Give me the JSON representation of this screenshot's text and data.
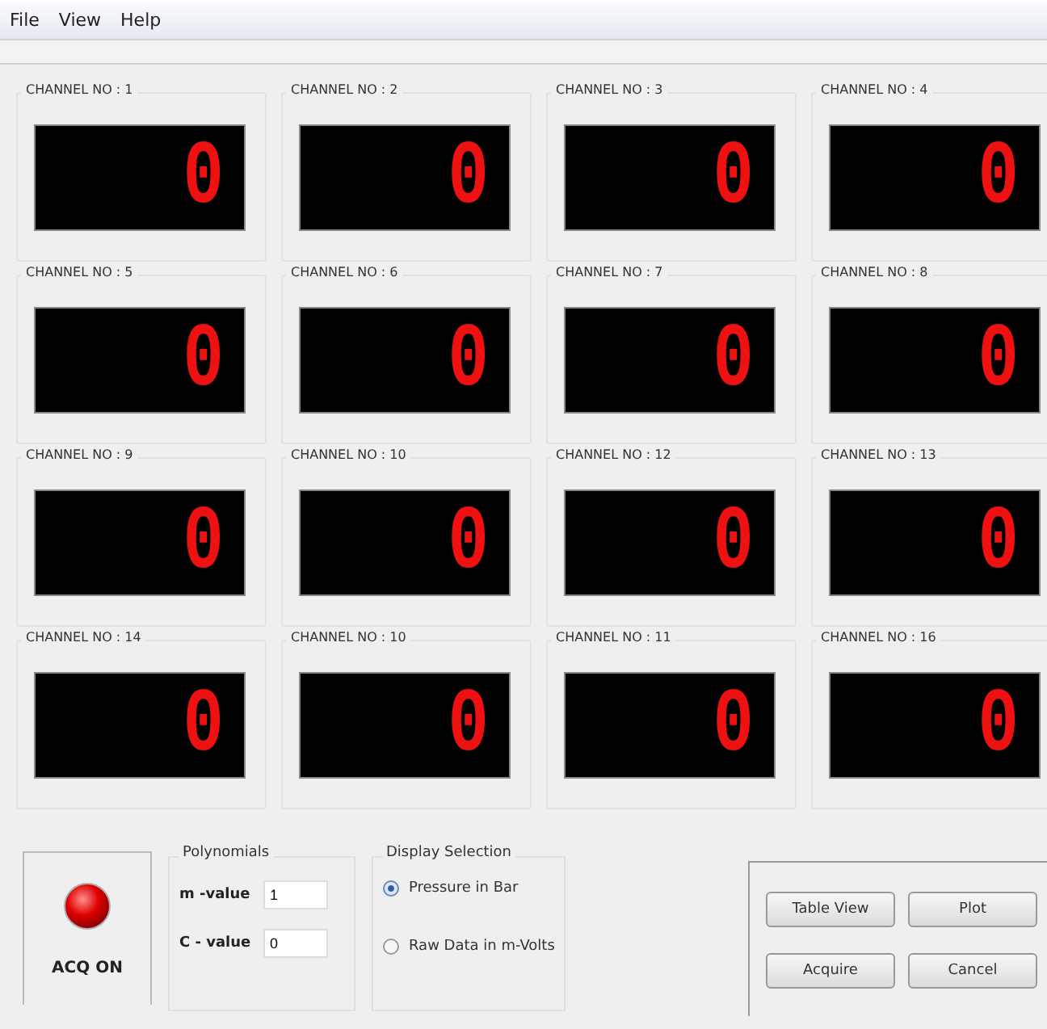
{
  "menu": [
    "File",
    "View",
    "Help"
  ],
  "channels": [
    {
      "label": "CHANNEL NO : 1",
      "value": "0"
    },
    {
      "label": "CHANNEL NO : 2",
      "value": "0"
    },
    {
      "label": "CHANNEL NO : 3",
      "value": "0"
    },
    {
      "label": "CHANNEL NO : 4",
      "value": "0"
    },
    {
      "label": "CHANNEL NO : 5",
      "value": "0"
    },
    {
      "label": "CHANNEL NO : 6",
      "value": "0"
    },
    {
      "label": "CHANNEL NO : 7",
      "value": "0"
    },
    {
      "label": "CHANNEL NO : 8",
      "value": "0"
    },
    {
      "label": "CHANNEL NO : 9",
      "value": "0"
    },
    {
      "label": "CHANNEL NO : 10",
      "value": "0"
    },
    {
      "label": "CHANNEL NO : 12",
      "value": "0"
    },
    {
      "label": "CHANNEL NO : 13",
      "value": "0"
    },
    {
      "label": "CHANNEL NO : 14",
      "value": "0"
    },
    {
      "label": "CHANNEL NO : 10",
      "value": "0"
    },
    {
      "label": "CHANNEL NO : 11",
      "value": "0"
    },
    {
      "label": "CHANNEL NO : 16",
      "value": "0"
    }
  ],
  "acquisition": {
    "label": "ACQ ON",
    "on": true
  },
  "polynomials": {
    "title": "Polynomials",
    "fields": [
      {
        "label": "m -value",
        "value": "1"
      },
      {
        "label": "C - value",
        "value": "0"
      }
    ]
  },
  "display_selection": {
    "title": "Display Selection",
    "options": [
      {
        "label": "Pressure in Bar",
        "selected": true
      },
      {
        "label": "Raw Data in m-Volts",
        "selected": false
      }
    ]
  },
  "buttons": [
    "Table View",
    "Plot",
    "Acquire",
    "Cancel"
  ]
}
